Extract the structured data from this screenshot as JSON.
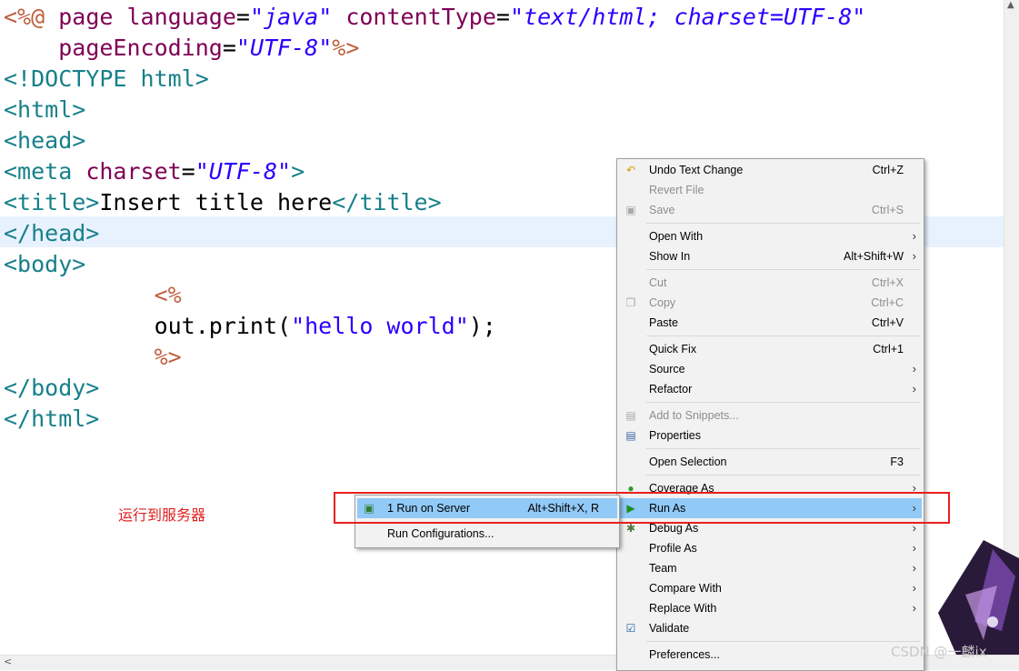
{
  "editor": {
    "lines": [
      {
        "segments": [
          {
            "c": "dir",
            "t": "<%@ "
          },
          {
            "c": "attr",
            "t": "page language"
          },
          {
            "c": "plain",
            "t": "="
          },
          {
            "c": "str",
            "t": "\"java\""
          },
          {
            "c": "plain",
            "t": " "
          },
          {
            "c": "attr",
            "t": "contentType"
          },
          {
            "c": "plain",
            "t": "="
          },
          {
            "c": "str",
            "t": "\"text/html; charset=UTF-8\""
          }
        ]
      },
      {
        "segments": [
          {
            "c": "plain",
            "t": "    "
          },
          {
            "c": "attr",
            "t": "pageEncoding"
          },
          {
            "c": "plain",
            "t": "="
          },
          {
            "c": "str",
            "t": "\"UTF-8\""
          },
          {
            "c": "dir",
            "t": "%>"
          }
        ]
      },
      {
        "segments": [
          {
            "c": "tag",
            "t": "<!DOCTYPE html>"
          }
        ]
      },
      {
        "segments": [
          {
            "c": "tag",
            "t": "<html>"
          }
        ]
      },
      {
        "segments": [
          {
            "c": "tag",
            "t": "<head>"
          }
        ]
      },
      {
        "segments": [
          {
            "c": "tag",
            "t": "<meta "
          },
          {
            "c": "attr",
            "t": "charset"
          },
          {
            "c": "plain",
            "t": "="
          },
          {
            "c": "str",
            "t": "\"UTF-8\""
          },
          {
            "c": "tag",
            "t": ">"
          }
        ]
      },
      {
        "segments": [
          {
            "c": "tag",
            "t": "<title>"
          },
          {
            "c": "plain",
            "t": "Insert title here"
          },
          {
            "c": "tag",
            "t": "</title>"
          }
        ]
      },
      {
        "segments": [
          {
            "c": "tag",
            "t": "</head>"
          }
        ]
      },
      {
        "segments": [
          {
            "c": "tag",
            "t": "<body>"
          }
        ]
      },
      {
        "segments": [
          {
            "c": "plain",
            "t": "           "
          },
          {
            "c": "dir",
            "t": "<%"
          }
        ]
      },
      {
        "segments": [
          {
            "c": "plain",
            "t": "           out.print("
          },
          {
            "c": "jstr",
            "t": "\"hello world\""
          },
          {
            "c": "plain",
            "t": ");"
          }
        ]
      },
      {
        "segments": [
          {
            "c": "plain",
            "t": "           "
          },
          {
            "c": "dir",
            "t": "%>"
          }
        ]
      },
      {
        "segments": [
          {
            "c": "tag",
            "t": "</body>"
          }
        ]
      },
      {
        "segments": [
          {
            "c": "tag",
            "t": "</html>"
          }
        ]
      }
    ]
  },
  "annotation": "运行到服务器",
  "context_menu": {
    "undo": {
      "label": "Undo Text Change",
      "acc": "Ctrl+Z"
    },
    "revert": {
      "label": "Revert File"
    },
    "save": {
      "label": "Save",
      "acc": "Ctrl+S"
    },
    "open_with": {
      "label": "Open With"
    },
    "show_in": {
      "label": "Show In",
      "acc": "Alt+Shift+W"
    },
    "cut": {
      "label": "Cut",
      "acc": "Ctrl+X"
    },
    "copy": {
      "label": "Copy",
      "acc": "Ctrl+C"
    },
    "paste": {
      "label": "Paste",
      "acc": "Ctrl+V"
    },
    "quick_fix": {
      "label": "Quick Fix",
      "acc": "Ctrl+1"
    },
    "source": {
      "label": "Source"
    },
    "refactor": {
      "label": "Refactor"
    },
    "add_snippets": {
      "label": "Add to Snippets..."
    },
    "properties": {
      "label": "Properties"
    },
    "open_selection": {
      "label": "Open Selection",
      "acc": "F3"
    },
    "coverage_as": {
      "label": "Coverage As"
    },
    "run_as": {
      "label": "Run As"
    },
    "debug_as": {
      "label": "Debug As"
    },
    "profile_as": {
      "label": "Profile As"
    },
    "team": {
      "label": "Team"
    },
    "compare_with": {
      "label": "Compare With"
    },
    "replace_with": {
      "label": "Replace With"
    },
    "validate": {
      "label": "Validate"
    },
    "preferences": {
      "label": "Preferences..."
    }
  },
  "submenu": {
    "run_on_server": {
      "label": "1 Run on Server",
      "acc": "Alt+Shift+X, R"
    },
    "run_configurations": {
      "label": "Run Configurations..."
    }
  },
  "watermark": "CSDN @一麟ix",
  "colors": {
    "selection": "#91c9f7",
    "highlight_box": "#e81f1f",
    "current_line": "#e8f2fe"
  }
}
